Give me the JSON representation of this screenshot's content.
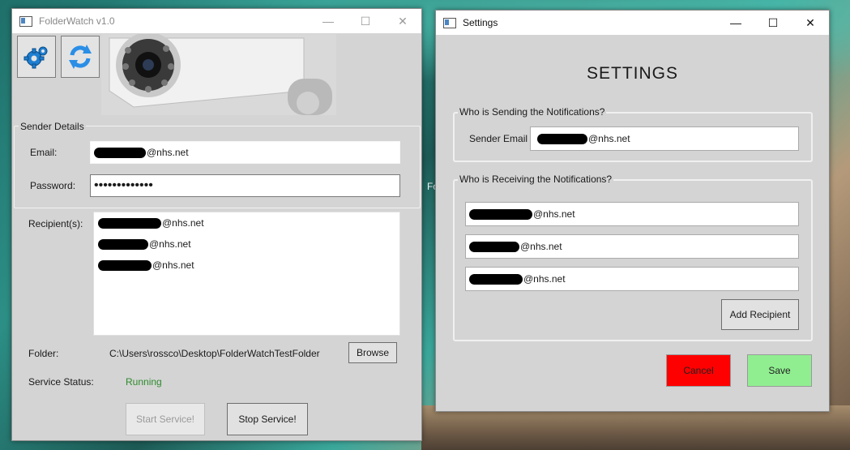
{
  "main_window": {
    "title": "FolderWatch v1.0",
    "controls": {
      "minimize": "—",
      "maximize": "☐",
      "close": "✕"
    },
    "toolbar": {
      "settings_icon": "gear-icon",
      "refresh_icon": "refresh-icon"
    },
    "sender": {
      "group_label": "Sender Details",
      "email_label": "Email:",
      "email_value": "@nhs.net",
      "password_label": "Password:",
      "password_value": "•••••••••••••"
    },
    "recipients": {
      "label": "Recipient(s):",
      "items": [
        "@nhs.net",
        "@nhs.net",
        "@nhs.net"
      ]
    },
    "folder": {
      "label": "Folder:",
      "path": "C:\\Users\\rossco\\Desktop\\FolderWatchTestFolder",
      "browse_label": "Browse"
    },
    "status": {
      "label": "Service Status:",
      "value": "Running",
      "value_color": "#2e8b2e"
    },
    "start_label": "Start Service!",
    "stop_label": "Stop Service!"
  },
  "settings_window": {
    "title": "Settings",
    "controls": {
      "minimize": "—",
      "maximize": "☐",
      "close": "✕"
    },
    "heading": "SETTINGS",
    "sending": {
      "group_label": "Who is Sending the Notifications?",
      "email_label": "Sender Email",
      "email_value": "@nhs.net"
    },
    "receiving": {
      "group_label": "Who is Receiving the Notifications?",
      "items": [
        "@nhs.net",
        "@nhs.net",
        "@nhs.net"
      ],
      "add_label": "Add Recipient"
    },
    "cancel_label": "Cancel",
    "cancel_color": "#ff0000",
    "save_label": "Save",
    "save_color": "#90ee90"
  },
  "desktop": {
    "partial_text": "Fo"
  }
}
